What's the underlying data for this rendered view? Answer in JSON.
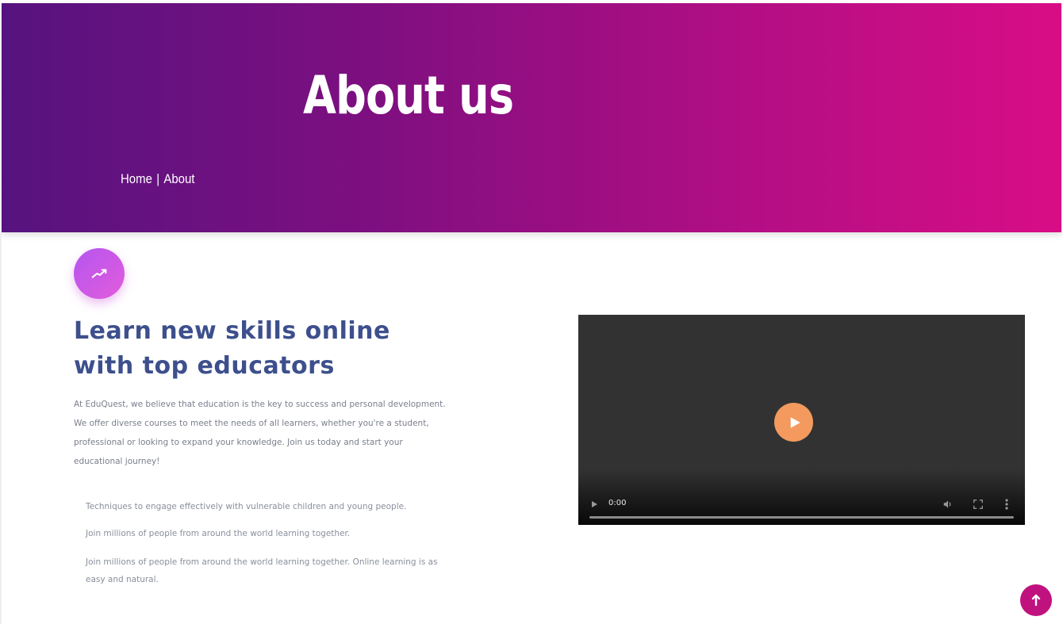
{
  "hero": {
    "title": "About us",
    "breadcrumb": {
      "home": "Home",
      "separator": "|",
      "current": "About"
    },
    "gradient_colors": [
      "#56137f",
      "#d80d86"
    ]
  },
  "intro": {
    "badge_icon": "trend-up-icon",
    "heading": "Learn new skills online with top educators",
    "paragraph": "At EduQuest, we believe that education is the key to success and personal development. We offer diverse courses to meet the needs of all learners, whether you're a student, professional or looking to expand your knowledge. Join us today and start your educational journey!",
    "features": [
      "Techniques to engage effectively with vulnerable children and young people.",
      "Join millions of people from around the world learning together.",
      "Join millions of people from around the world learning together. Online learning is as easy and natural."
    ]
  },
  "video": {
    "time": "0:00",
    "play_icon": "play-icon",
    "accent": "#f49a5e"
  },
  "scroll_top": {
    "icon": "arrow-up-icon",
    "color": "#c0127f"
  }
}
